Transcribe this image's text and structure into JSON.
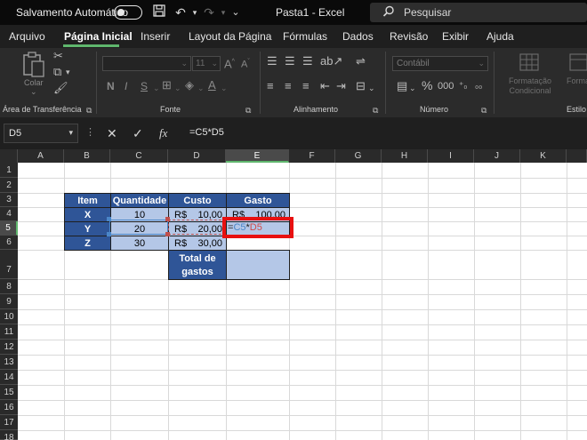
{
  "titlebar": {
    "autosave_label": "Salvamento Automático",
    "toggle_state": "Off",
    "document_title": "Pasta1  -  Excel",
    "search_placeholder": "Pesquisar"
  },
  "menu": {
    "tabs": [
      "Arquivo",
      "Página Inicial",
      "Inserir",
      "Layout da Página",
      "Fórmulas",
      "Dados",
      "Revisão",
      "Exibir",
      "Ajuda"
    ],
    "active_tab": "Página Inicial"
  },
  "ribbon": {
    "groups": {
      "clipboard": "Área de Transferência",
      "font": "Fonte",
      "alignment": "Alinhamento",
      "number": "Número",
      "styles": "Estilo"
    },
    "paste_label": "Colar",
    "font_size": "11",
    "bold": "N",
    "italic": "I",
    "underline": "S",
    "number_format": "Contábil",
    "conditional_formatting": "Formatação Condicional",
    "format_table": "Formatar como Tabela",
    "percent_sign": "%"
  },
  "formula_bar": {
    "name_box": "D5",
    "formula": "=C5*D5"
  },
  "grid": {
    "columns": [
      "A",
      "B",
      "C",
      "D",
      "E",
      "F",
      "G",
      "H",
      "I",
      "J",
      "K"
    ],
    "rows": [
      "1",
      "2",
      "3",
      "4",
      "5",
      "6",
      "7",
      "8",
      "9",
      "10",
      "11",
      "12",
      "13",
      "14",
      "15",
      "16",
      "17",
      "18"
    ],
    "selected_column": "E",
    "selected_row": "5"
  },
  "table": {
    "headers": [
      "Item",
      "Quantidade",
      "Custo",
      "Gasto"
    ],
    "items": [
      "X",
      "Y",
      "Z"
    ],
    "quantities": [
      "10",
      "20",
      "30"
    ],
    "currency": "R$",
    "costs": [
      "10,00",
      "20,00",
      "30,00"
    ],
    "spend_row1": "100,00",
    "total_label": "Total de gastos",
    "editing_formula": {
      "eq": "=",
      "ref1": "C5",
      "op": "*",
      "ref2": "D5"
    }
  },
  "colors": {
    "header_fill": "#2f5597",
    "cell_fill": "#b4c7e7",
    "highlight_box": "#e81010",
    "ref_c5": "#4a86c8",
    "ref_d5": "#d04848",
    "accent": "#5fb66d"
  }
}
